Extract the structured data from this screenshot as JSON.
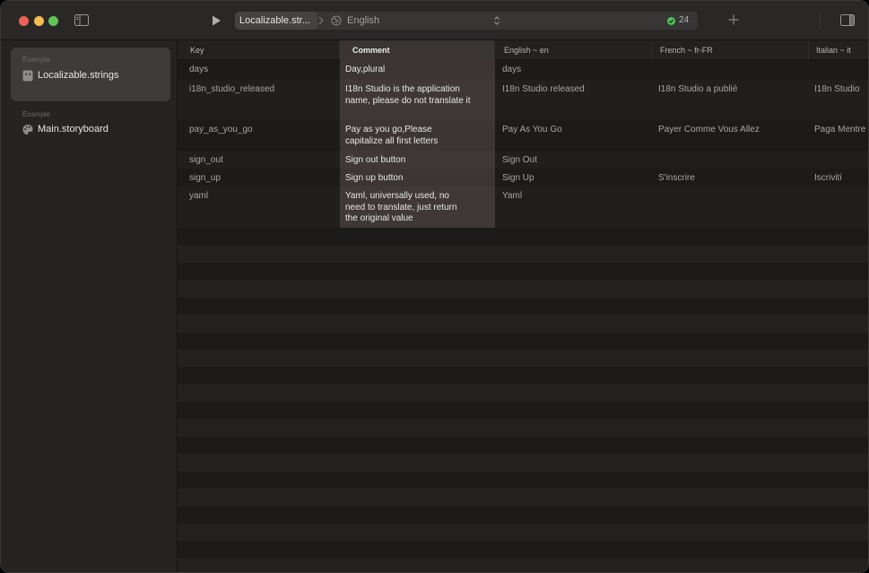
{
  "toolbar": {
    "file_chip": "Localizable.str...",
    "language": "English",
    "status_count": "24"
  },
  "sidebar": {
    "groups": [
      {
        "label": "Example",
        "item": {
          "label": "Localizable.strings",
          "icon": "strings-file-icon",
          "selected": true
        }
      },
      {
        "label": "Example",
        "item": {
          "label": "Main.storyboard",
          "icon": "palette-icon",
          "selected": false
        }
      }
    ]
  },
  "table": {
    "columns": [
      "Key",
      "Comment",
      "English ~ en",
      "French ~ fr-FR",
      "Italian ~ it"
    ],
    "selected_column": "Comment",
    "rows": [
      {
        "key": "days",
        "comment": "Day,plural",
        "en": "days",
        "fr": "",
        "it": ""
      },
      {
        "key": "i18n_studio_released",
        "comment": "I18n Studio is the application name, please do not translate it",
        "en": "I18n Studio released",
        "fr": "I18n Studio a publié",
        "it": "I18n Studio"
      },
      {
        "key": "pay_as_you_go",
        "comment": "Pay as you go,Please capitalize all first letters",
        "en": "Pay As You Go",
        "fr": "Payer Comme Vous Allez",
        "it": "Paga Mentre"
      },
      {
        "key": "sign_out",
        "comment": "Sign out button",
        "en": "Sign Out",
        "fr": "",
        "it": ""
      },
      {
        "key": "sign_up",
        "comment": "Sign up button",
        "en": "Sign Up",
        "fr": "S'inscrire",
        "it": "Iscriviti"
      },
      {
        "key": "yaml",
        "comment": "Yaml, universally used, no need to translate, just return the original value",
        "en": "Yaml",
        "fr": "",
        "it": ""
      }
    ]
  },
  "colors": {
    "close": "#ee5f57",
    "minimize": "#f4bd4f",
    "zoom": "#5fc453",
    "status_ok": "#4cc15a"
  }
}
